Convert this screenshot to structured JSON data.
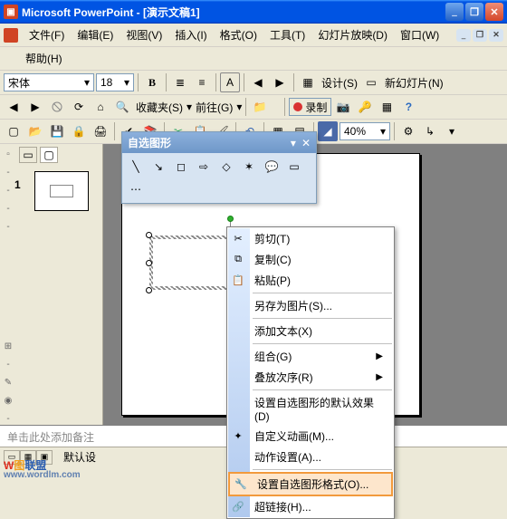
{
  "title": "Microsoft PowerPoint - [演示文稿1]",
  "menu": {
    "file": "文件(F)",
    "edit": "编辑(E)",
    "view": "视图(V)",
    "insert": "插入(I)",
    "format": "格式(O)",
    "tools": "工具(T)",
    "slideshow": "幻灯片放映(D)",
    "window": "窗口(W)",
    "help": "帮助(H)"
  },
  "font": {
    "name": "宋体",
    "size": "18",
    "bold": "B",
    "design": "设计(S)",
    "newslide": "新幻灯片(N)"
  },
  "tb2": {
    "fav": "收藏夹(S)",
    "goto": "前往(G)",
    "rec": "录制"
  },
  "zoom": "40%",
  "thumb": {
    "num": "1"
  },
  "floating": {
    "title": "自选图形"
  },
  "ctx": {
    "cut": "剪切(T)",
    "copy": "复制(C)",
    "paste": "粘贴(P)",
    "saveimg": "另存为图片(S)...",
    "addtext": "添加文本(X)",
    "group": "组合(G)",
    "order": "叠放次序(R)",
    "defaults": "设置自选图形的默认效果(D)",
    "anim": "自定义动画(M)...",
    "action": "动作设置(A)...",
    "format": "设置自选图形格式(O)...",
    "hyperlink": "超链接(H)..."
  },
  "notes": "单击此处添加备注",
  "status": {
    "label": "默认设"
  },
  "watermark": {
    "brand": "W图联盟",
    "url": "www.wordlm.com"
  }
}
